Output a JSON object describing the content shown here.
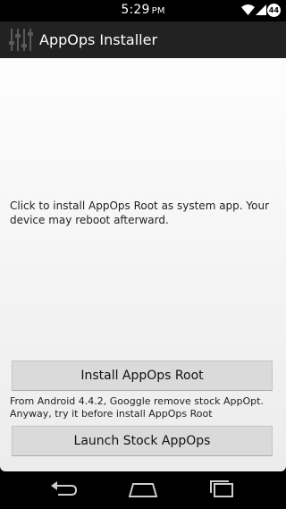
{
  "status_bar": {
    "time": "5:29",
    "ampm": "PM",
    "battery": "44"
  },
  "action_bar": {
    "title": "AppOps Installer"
  },
  "main": {
    "install_description": "Click to install AppOps Root as system app. Your device may reboot afterward.",
    "install_button": "Install AppOps Root",
    "android_note": "From Android 4.4.2, Googgle remove stock AppOpt. Anyway, try it before install AppOps Root",
    "launch_button": "Launch Stock AppOps"
  },
  "icons": {
    "app": "sliders-icon",
    "wifi": "wifi-icon",
    "signal": "cell-signal-icon",
    "back": "back-icon",
    "home": "home-icon",
    "recent": "recent-apps-icon"
  },
  "colors": {
    "action_bar": "#222222",
    "button": "#dadada",
    "background": "#000000"
  }
}
